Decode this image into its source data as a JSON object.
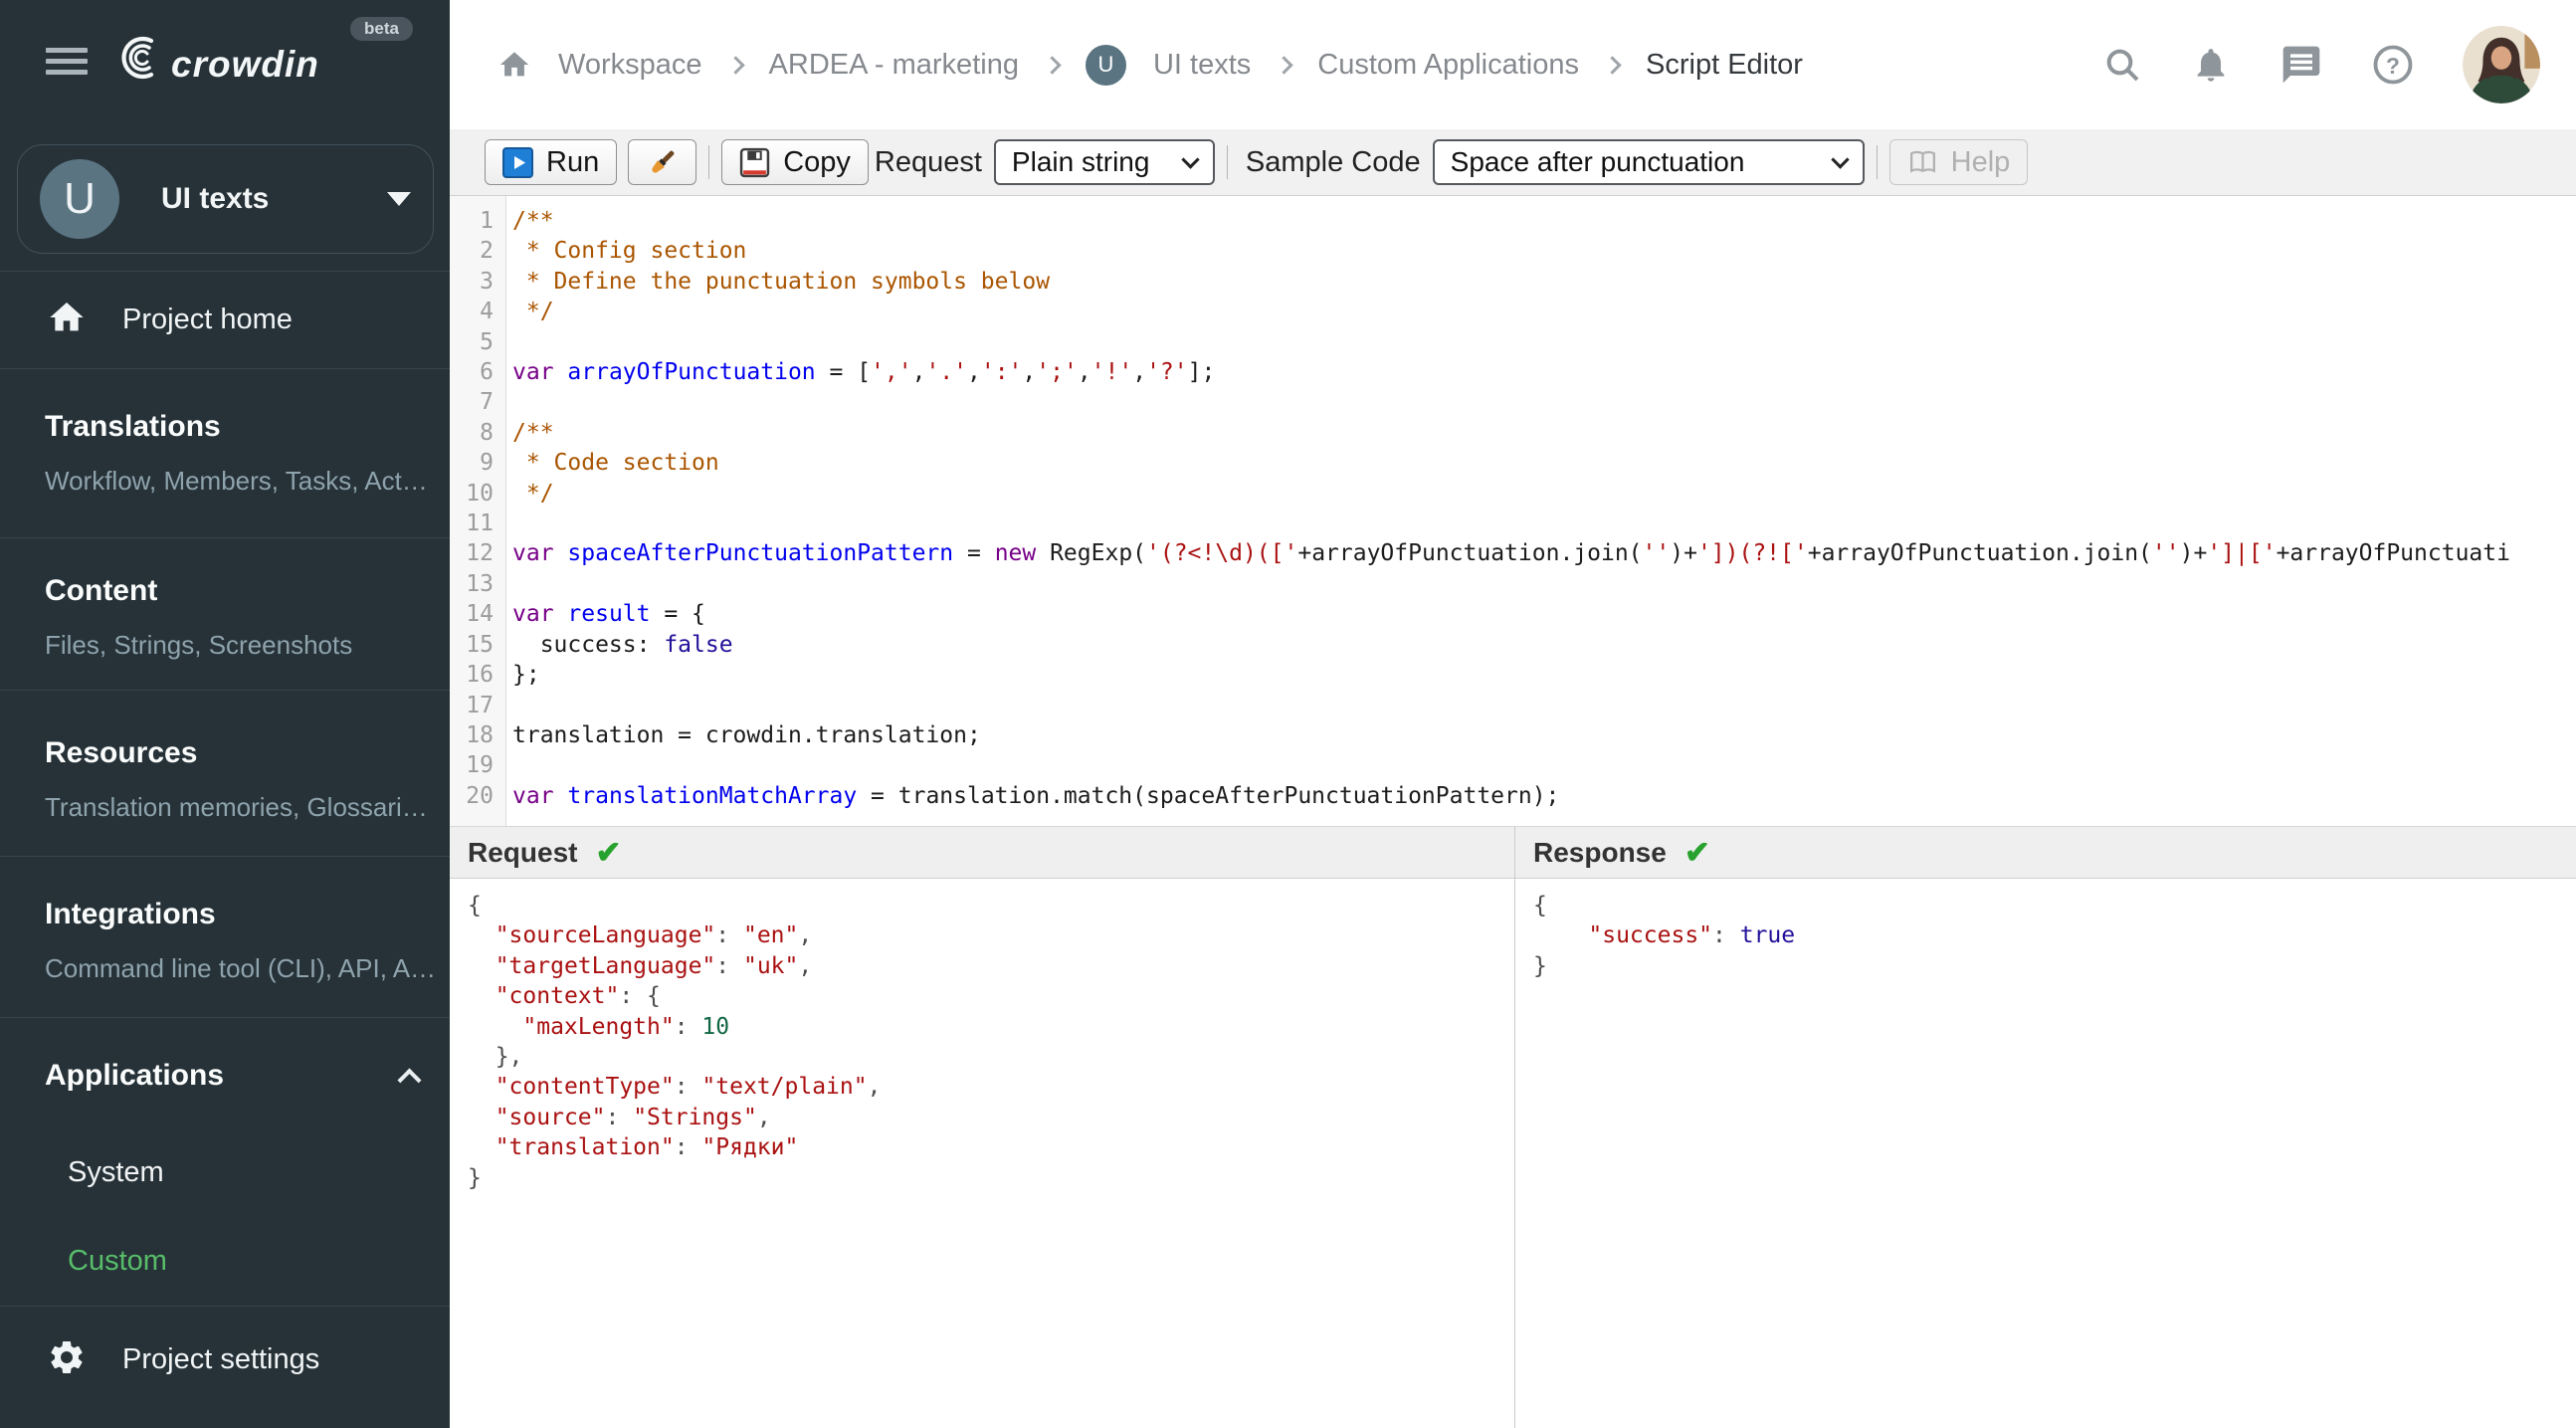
{
  "brand": {
    "logo": "crowdin",
    "beta_badge": "beta"
  },
  "project_switcher": {
    "avatar_letter": "U",
    "name": "UI texts"
  },
  "sidebar": {
    "project_home": "Project home",
    "sections": [
      {
        "title": "Translations",
        "subtitle": "Workflow, Members, Tasks, Act…"
      },
      {
        "title": "Content",
        "subtitle": "Files, Strings, Screenshots"
      },
      {
        "title": "Resources",
        "subtitle": "Translation memories, Glossari…"
      },
      {
        "title": "Integrations",
        "subtitle": "Command line tool (CLI), API, A…"
      }
    ],
    "applications": {
      "title": "Applications",
      "items": [
        {
          "label": "System",
          "active": false
        },
        {
          "label": "Custom",
          "active": true
        }
      ]
    },
    "project_settings": "Project settings"
  },
  "breadcrumb": {
    "project_chip_letter": "U",
    "items": [
      "Workspace",
      "ARDEA - marketing",
      "UI texts",
      "Custom Applications",
      "Script Editor"
    ]
  },
  "toolbar": {
    "run_label": "Run",
    "copy_label": "Copy",
    "request_label": "Request",
    "request_value": "Plain string",
    "sample_code_label": "Sample Code",
    "sample_code_value": "Space after punctuation",
    "help_label": "Help"
  },
  "editor": {
    "lines": [
      {
        "n": "1",
        "s": [
          [
            "cm-comment",
            "/**"
          ]
        ]
      },
      {
        "n": "2",
        "s": [
          [
            "cm-comment",
            " * Config section"
          ]
        ]
      },
      {
        "n": "3",
        "s": [
          [
            "cm-comment",
            " * Define the punctuation symbols below"
          ]
        ]
      },
      {
        "n": "4",
        "s": [
          [
            "cm-comment",
            " */"
          ]
        ]
      },
      {
        "n": "5",
        "s": []
      },
      {
        "n": "6",
        "s": [
          [
            "cm-keyword",
            "var"
          ],
          [
            "cm-plain",
            " "
          ],
          [
            "cm-def",
            "arrayOfPunctuation"
          ],
          [
            "cm-plain",
            " = ["
          ],
          [
            "cm-string",
            "','"
          ],
          [
            "cm-plain",
            ","
          ],
          [
            "cm-string",
            "'.'"
          ],
          [
            "cm-plain",
            ","
          ],
          [
            "cm-string",
            "':'"
          ],
          [
            "cm-plain",
            ","
          ],
          [
            "cm-string",
            "';'"
          ],
          [
            "cm-plain",
            ","
          ],
          [
            "cm-string",
            "'!'"
          ],
          [
            "cm-plain",
            ","
          ],
          [
            "cm-string",
            "'?'"
          ],
          [
            "cm-plain",
            "];"
          ]
        ]
      },
      {
        "n": "7",
        "s": []
      },
      {
        "n": "8",
        "s": [
          [
            "cm-comment",
            "/**"
          ]
        ]
      },
      {
        "n": "9",
        "s": [
          [
            "cm-comment",
            " * Code section"
          ]
        ]
      },
      {
        "n": "10",
        "s": [
          [
            "cm-comment",
            " */"
          ]
        ]
      },
      {
        "n": "11",
        "s": []
      },
      {
        "n": "12",
        "s": [
          [
            "cm-keyword",
            "var"
          ],
          [
            "cm-plain",
            " "
          ],
          [
            "cm-def",
            "spaceAfterPunctuationPattern"
          ],
          [
            "cm-plain",
            " = "
          ],
          [
            "cm-keyword",
            "new"
          ],
          [
            "cm-plain",
            " RegExp("
          ],
          [
            "cm-string",
            "'(?<!\\d)(['"
          ],
          [
            "cm-plain",
            "+arrayOfPunctuation.join("
          ],
          [
            "cm-string",
            "''"
          ],
          [
            "cm-plain",
            ")+"
          ],
          [
            "cm-string",
            "'])(?!['"
          ],
          [
            "cm-plain",
            "+arrayOfPunctuation.join("
          ],
          [
            "cm-string",
            "''"
          ],
          [
            "cm-plain",
            ")+"
          ],
          [
            "cm-string",
            "']|['"
          ],
          [
            "cm-plain",
            "+arrayOfPunctuati"
          ]
        ]
      },
      {
        "n": "13",
        "s": []
      },
      {
        "n": "14",
        "s": [
          [
            "cm-keyword",
            "var"
          ],
          [
            "cm-plain",
            " "
          ],
          [
            "cm-def",
            "result"
          ],
          [
            "cm-plain",
            " = {"
          ]
        ]
      },
      {
        "n": "15",
        "s": [
          [
            "cm-plain",
            "  success: "
          ],
          [
            "cm-atom",
            "false"
          ]
        ]
      },
      {
        "n": "16",
        "s": [
          [
            "cm-plain",
            "};"
          ]
        ]
      },
      {
        "n": "17",
        "s": []
      },
      {
        "n": "18",
        "s": [
          [
            "cm-plain",
            "translation = crowdin.translation;"
          ]
        ]
      },
      {
        "n": "19",
        "s": []
      },
      {
        "n": "20",
        "s": [
          [
            "cm-keyword",
            "var"
          ],
          [
            "cm-plain",
            " "
          ],
          [
            "cm-def",
            "translationMatchArray"
          ],
          [
            "cm-plain",
            " = translation.match(spaceAfterPunctuationPattern);"
          ]
        ]
      }
    ]
  },
  "panels": {
    "request": {
      "title": "Request",
      "check_glyph": "✔",
      "lines": [
        {
          "s": [
            [
              "cm-punct",
              "{"
            ]
          ]
        },
        {
          "s": [
            [
              "cm-plain",
              "  "
            ],
            [
              "cm-string",
              "\"sourceLanguage\""
            ],
            [
              "cm-punct",
              ": "
            ],
            [
              "cm-string",
              "\"en\""
            ],
            [
              "cm-punct",
              ","
            ]
          ]
        },
        {
          "s": [
            [
              "cm-plain",
              "  "
            ],
            [
              "cm-string",
              "\"targetLanguage\""
            ],
            [
              "cm-punct",
              ": "
            ],
            [
              "cm-string",
              "\"uk\""
            ],
            [
              "cm-punct",
              ","
            ]
          ]
        },
        {
          "s": [
            [
              "cm-plain",
              "  "
            ],
            [
              "cm-string",
              "\"context\""
            ],
            [
              "cm-punct",
              ": {"
            ]
          ]
        },
        {
          "s": [
            [
              "cm-plain",
              "    "
            ],
            [
              "cm-string",
              "\"maxLength\""
            ],
            [
              "cm-punct",
              ": "
            ],
            [
              "cm-number",
              "10"
            ]
          ]
        },
        {
          "s": [
            [
              "cm-plain",
              "  "
            ],
            [
              "cm-punct",
              "},"
            ]
          ]
        },
        {
          "s": [
            [
              "cm-plain",
              "  "
            ],
            [
              "cm-string",
              "\"contentType\""
            ],
            [
              "cm-punct",
              ": "
            ],
            [
              "cm-string",
              "\"text/plain\""
            ],
            [
              "cm-punct",
              ","
            ]
          ]
        },
        {
          "s": [
            [
              "cm-plain",
              "  "
            ],
            [
              "cm-string",
              "\"source\""
            ],
            [
              "cm-punct",
              ": "
            ],
            [
              "cm-string",
              "\"Strings\""
            ],
            [
              "cm-punct",
              ","
            ]
          ]
        },
        {
          "s": [
            [
              "cm-plain",
              "  "
            ],
            [
              "cm-string",
              "\"translation\""
            ],
            [
              "cm-punct",
              ": "
            ],
            [
              "cm-string",
              "\"Рядки\""
            ]
          ]
        },
        {
          "s": [
            [
              "cm-punct",
              "}"
            ]
          ]
        }
      ]
    },
    "response": {
      "title": "Response",
      "check_glyph": "✔",
      "lines": [
        {
          "s": [
            [
              "cm-punct",
              "{"
            ]
          ]
        },
        {
          "s": [
            [
              "cm-plain",
              "    "
            ],
            [
              "cm-string",
              "\"success\""
            ],
            [
              "cm-punct",
              ": "
            ],
            [
              "cm-atom",
              "true"
            ]
          ]
        },
        {
          "s": [
            [
              "cm-punct",
              "}"
            ]
          ]
        }
      ]
    }
  },
  "colors": {
    "sidebar_bg": "#263238",
    "accent_green": "#58bd69",
    "run_icon_blue": "#1f7fd6",
    "status_check_green": "#28a22e",
    "syntax_comment": "#aa5500",
    "syntax_keyword": "#770088",
    "syntax_def": "#0000ee",
    "syntax_string": "#aa1111",
    "syntax_atom": "#221199",
    "syntax_number": "#116644"
  }
}
